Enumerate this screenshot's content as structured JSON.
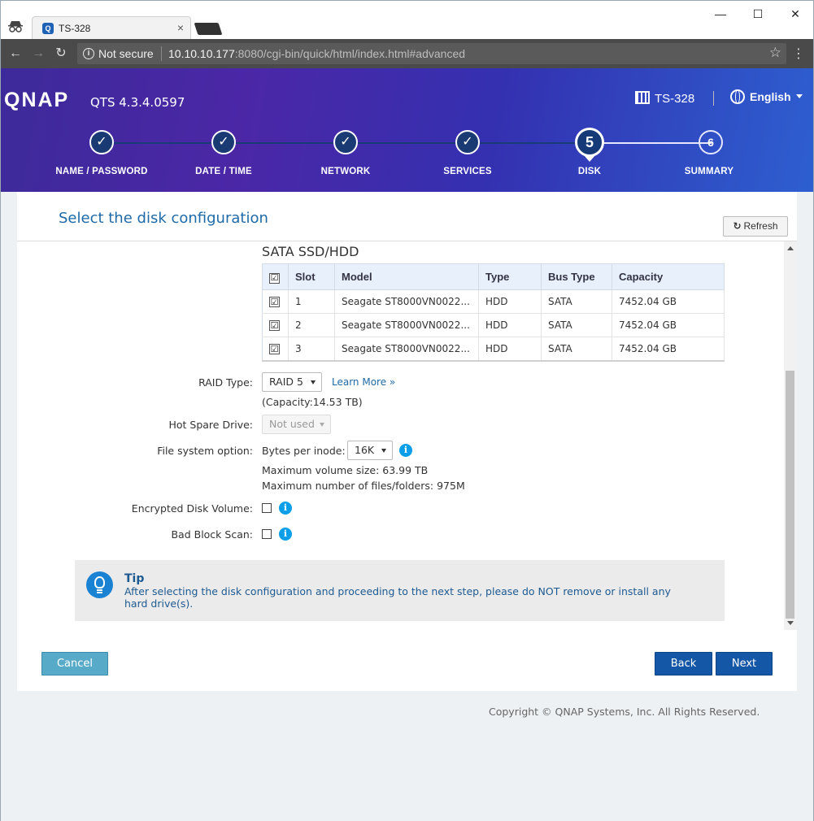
{
  "browser": {
    "tab_title": "TS-328",
    "tab_favicon": "Q",
    "close_glyph": "×",
    "not_secure": "Not secure",
    "url_host": "10.10.10.177",
    "url_rest": ":8080/cgi-bin/quick/html/index.html#advanced",
    "window_minimize": "—",
    "window_maximize": "☐",
    "window_close": "✕",
    "back_glyph": "←",
    "forward_glyph": "→",
    "reload_glyph": "↻",
    "star_glyph": "☆",
    "menu_glyph": "⋮"
  },
  "header": {
    "logo": "QNAP",
    "version": "QTS 4.3.4.0597",
    "model": "TS-328",
    "language": "English"
  },
  "steps": [
    {
      "label": "NAME / PASSWORD",
      "state": "done",
      "mark": "✓"
    },
    {
      "label": "DATE / TIME",
      "state": "done",
      "mark": "✓"
    },
    {
      "label": "NETWORK",
      "state": "done",
      "mark": "✓"
    },
    {
      "label": "SERVICES",
      "state": "done",
      "mark": "✓"
    },
    {
      "label": "DISK",
      "state": "active",
      "mark": "5"
    },
    {
      "label": "SUMMARY",
      "state": "todo",
      "mark": "6"
    }
  ],
  "panel": {
    "title": "Select the disk configuration",
    "refresh_label": "Refresh",
    "section_title": "SATA SSD/HDD",
    "table": {
      "headers": [
        "Slot",
        "Model",
        "Type",
        "Bus Type",
        "Capacity"
      ],
      "check_glyph": "☑",
      "rows": [
        {
          "slot": "1",
          "model": "Seagate ST8000VN0022...",
          "type": "HDD",
          "bus": "SATA",
          "capacity": "7452.04 GB"
        },
        {
          "slot": "2",
          "model": "Seagate ST8000VN0022...",
          "type": "HDD",
          "bus": "SATA",
          "capacity": "7452.04 GB"
        },
        {
          "slot": "3",
          "model": "Seagate ST8000VN0022...",
          "type": "HDD",
          "bus": "SATA",
          "capacity": "7452.04 GB"
        }
      ]
    },
    "raid_label": "RAID Type:",
    "raid_value": "RAID 5",
    "learn_more": "Learn More »",
    "capacity": "(Capacity:14.53 TB)",
    "hot_spare_label": "Hot Spare Drive:",
    "hot_spare_value": "Not used",
    "fs_label": "File system option:",
    "bytes_per_inode_label": "Bytes per inode:",
    "bytes_per_inode_value": "16K",
    "max_volume": "Maximum volume size: 63.99 TB",
    "max_files": "Maximum number of files/folders: 975M",
    "encrypted_label": "Encrypted Disk Volume:",
    "bad_block_label": "Bad Block Scan:",
    "info_glyph": "i",
    "tip_title": "Tip",
    "tip_text": "After selecting the disk configuration and proceeding to the next step, please do NOT remove or install any hard drive(s)."
  },
  "buttons": {
    "cancel": "Cancel",
    "back": "Back",
    "next": "Next"
  },
  "footer": {
    "copyright": "Copyright © QNAP Systems, Inc. All Rights Reserved."
  }
}
